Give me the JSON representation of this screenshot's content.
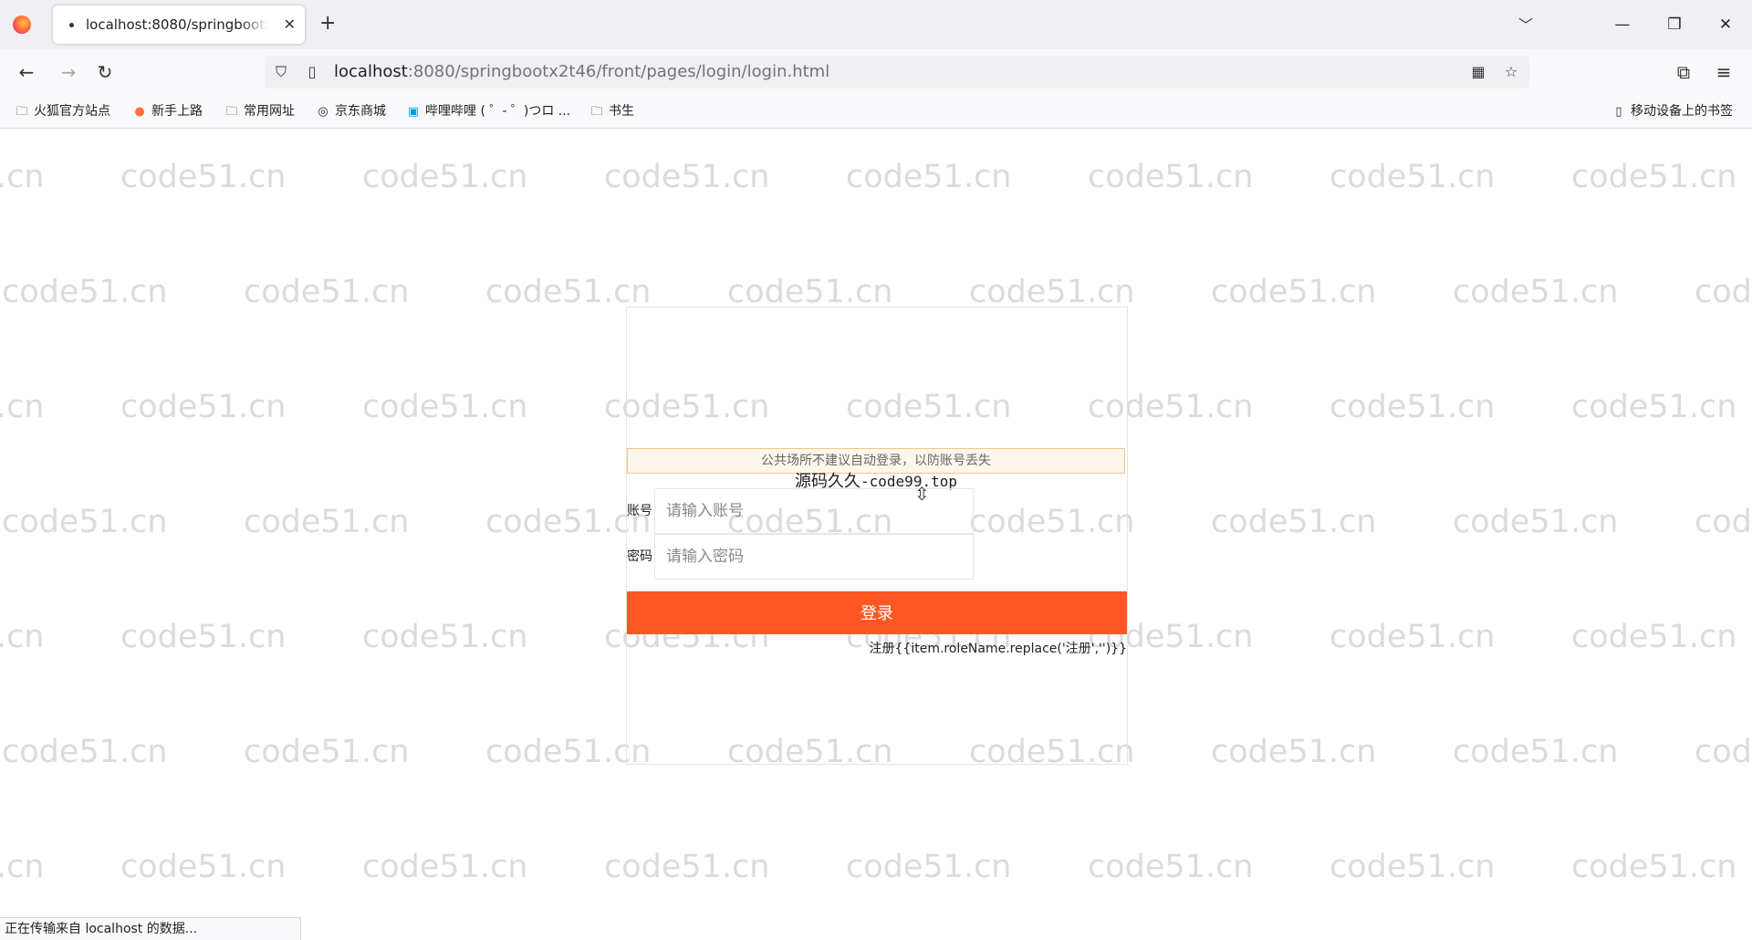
{
  "browser": {
    "tab_title": "localhost:8080/springbootx2t46/front/pages/login/login.html",
    "url_host": "localhost",
    "url_rest": ":8080/springbootx2t46/front/pages/login/login.html",
    "status_text": "正在传输来自 localhost 的数据..."
  },
  "bookmarks": {
    "items": [
      {
        "label": "火狐官方站点",
        "icon": "folder-icon"
      },
      {
        "label": "新手上路",
        "icon": "firefox-icon"
      },
      {
        "label": "常用网址",
        "icon": "folder-icon"
      },
      {
        "label": "京东商城",
        "icon": "globe-icon"
      },
      {
        "label": "哔哩哔哩 ( ゜- ゜)つロ ...",
        "icon": "bilibili-icon"
      },
      {
        "label": "书生",
        "icon": "folder-icon"
      }
    ],
    "mobile": "移动设备上的书签"
  },
  "watermark": {
    "text": "code51.cn"
  },
  "login": {
    "notice": "公共场所不建议自动登录，以防账号丢失",
    "site_title_cn": "源码久久",
    "site_title_en": "-code99.top",
    "account_label": "账号",
    "account_placeholder": "请输入账号",
    "password_label": "密码",
    "password_placeholder": "请输入密码",
    "login_button": "登录",
    "register_link": "注册{{item.roleName.replace('注册','')}}"
  },
  "colors": {
    "accent": "#ff5722",
    "notice_bg": "#fdf6ec",
    "notice_border": "#f0c78a"
  }
}
